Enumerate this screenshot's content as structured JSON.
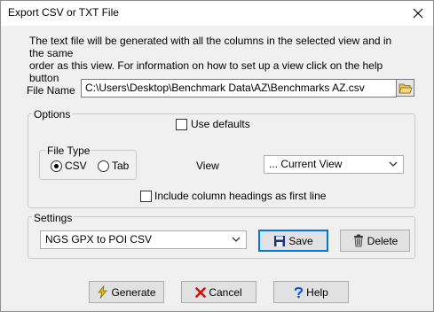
{
  "window": {
    "title": "Export CSV or TXT File"
  },
  "intro": {
    "line1": "The text file will be generated with all the columns in the selected view and in the same",
    "line2": "order as this view. For information on how to set up a view click on the help button"
  },
  "file_name": {
    "label": "File Name",
    "value": "C:\\Users\\Desktop\\Benchmark Data\\AZ\\Benchmarks AZ.csv"
  },
  "options": {
    "legend": "Options",
    "use_defaults": {
      "label": "Use defaults",
      "checked": false
    },
    "file_type": {
      "legend": "File Type",
      "csv_label": "CSV",
      "tab_label": "Tab",
      "selected": "CSV"
    },
    "view": {
      "label": "View",
      "value": "... Current View"
    },
    "include_headings": {
      "label": "Include column headings as first line",
      "checked": false
    }
  },
  "settings": {
    "legend": "Settings",
    "preset": "NGS GPX to POI CSV",
    "save_label": "Save",
    "delete_label": "Delete"
  },
  "footer": {
    "generate_label": "Generate",
    "cancel_label": "Cancel",
    "help_label": "Help"
  },
  "icons": {
    "generate": "lightning-icon",
    "cancel": "red-x-icon",
    "help": "question-icon",
    "save": "floppy-disk-icon",
    "delete": "trash-can-icon",
    "browse": "open-folder-icon",
    "close": "close-icon"
  },
  "colors": {
    "focus_border": "#0078d7",
    "cancel_x": "#d01010",
    "generate_bolt": "#e6c200",
    "help_q": "#1a58c8"
  }
}
